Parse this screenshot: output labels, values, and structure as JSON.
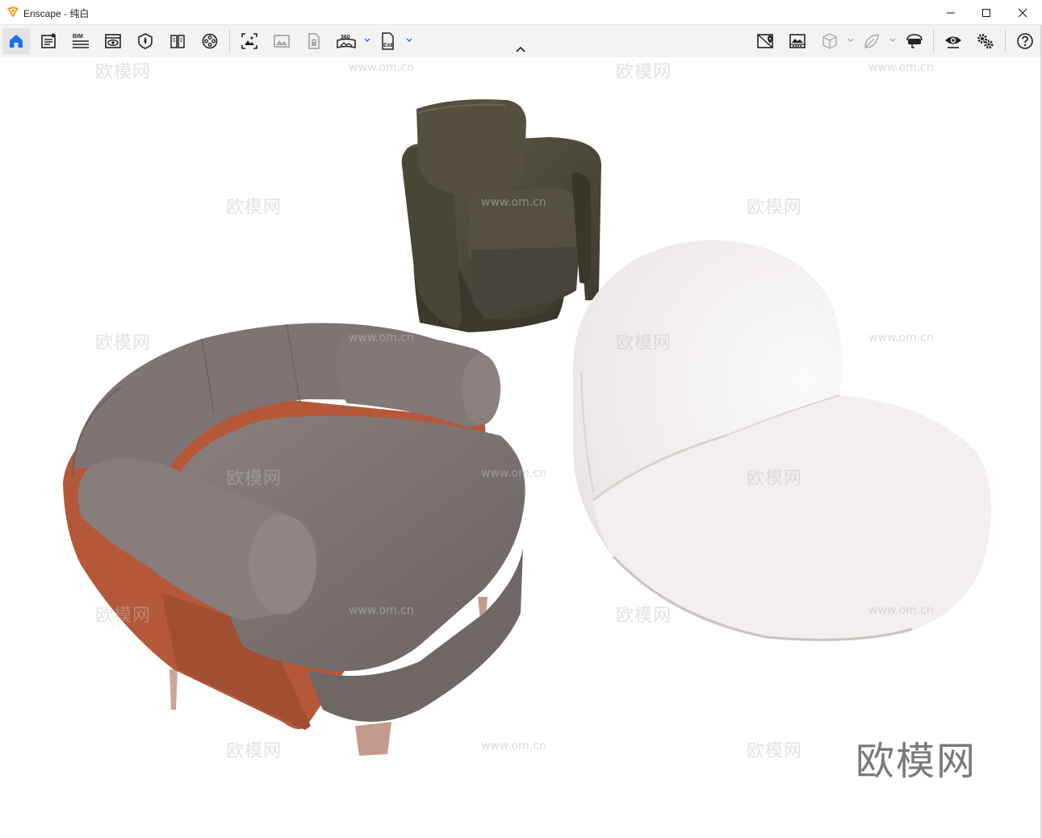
{
  "window": {
    "app_name": "Enscape",
    "separator": " - ",
    "view_name": "纯白",
    "minimize_icon": "minimize-icon",
    "maximize_icon": "maximize-icon",
    "close_icon": "close-icon"
  },
  "toolbar": {
    "left_items": [
      {
        "name": "home-icon",
        "active": true
      },
      {
        "name": "document-icon"
      },
      {
        "name": "bim-icon",
        "label": "BIM"
      },
      {
        "name": "view-eye-icon"
      },
      {
        "name": "shield-icon"
      },
      {
        "name": "book-icon"
      },
      {
        "name": "film-reel-icon"
      },
      {
        "name": "screenshot-icon"
      },
      {
        "name": "image-icon"
      },
      {
        "name": "lock-file-icon"
      },
      {
        "name": "panorama-360-icon",
        "label": "360"
      },
      {
        "name": "exe-export-icon",
        "label": "EXE"
      }
    ],
    "right_items": [
      {
        "name": "map-pin-icon"
      },
      {
        "name": "gallery-icon"
      },
      {
        "name": "cube-icon"
      },
      {
        "name": "leaf-icon"
      },
      {
        "name": "vr-headset-icon"
      },
      {
        "name": "visual-settings-eye-icon"
      },
      {
        "name": "settings-gears-icon"
      },
      {
        "name": "help-icon"
      }
    ],
    "collapse_icon": "chevron-up-icon"
  },
  "viewport": {
    "watermark_text": "欧模网",
    "watermark_url": "www.om.cn",
    "brand_text": "欧模网",
    "objects": [
      "armchair-dark-leather",
      "armchair-grey-velvet",
      "lounge-chair-white"
    ]
  },
  "colors": {
    "home_icon": "#1a73e8",
    "toolbar_bg": "#f3f3f3",
    "leather": "#4f4a3a",
    "velvet": "#7d7373",
    "leather_trim": "#b5583a",
    "boucle": "#efeceb"
  }
}
